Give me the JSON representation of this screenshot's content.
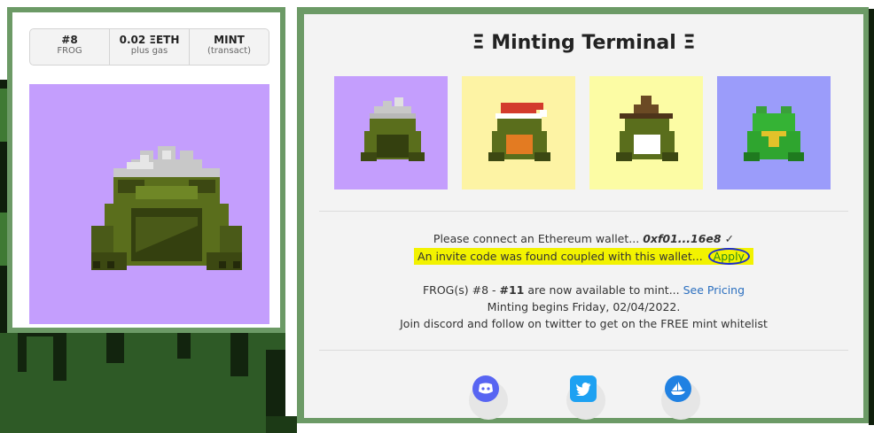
{
  "mint_card": {
    "stats": [
      {
        "top": "#8",
        "bottom": "FROG"
      },
      {
        "top": "0.02 ΞETH",
        "bottom": "plus gas"
      },
      {
        "top": "MINT",
        "bottom": "(transact)"
      }
    ]
  },
  "terminal": {
    "title": "Ξ Minting Terminal Ξ",
    "wallet": {
      "prefix": "Please connect an Ethereum wallet...",
      "address": "0xf01...16e8",
      "check": "✓"
    },
    "invite": {
      "text": "An invite code was found coupled with this wallet...",
      "apply_label": "Apply"
    },
    "availability": {
      "prefix": "FROG(s) #8 - ",
      "last": "#11",
      "suffix": " are now available to mint...",
      "link": "See Pricing"
    },
    "minting_begins": "Minting begins Friday, 02/04/2022.",
    "whitelist": "Join discord and follow on twitter to get on the FREE mint whitelist"
  },
  "socials": [
    {
      "name": "discord",
      "color": "#5865f2"
    },
    {
      "name": "twitter",
      "color": "#1da1f2"
    },
    {
      "name": "opensea",
      "color": "#2081e2"
    }
  ],
  "colors": {
    "frame_green": "#6c9a66",
    "tile_purple": "#c49efd",
    "tile_yellow": "#fdf3a4",
    "tile_yellow2": "#fcfca4",
    "tile_blue": "#9b9cfa",
    "highlight": "#f2f200"
  }
}
